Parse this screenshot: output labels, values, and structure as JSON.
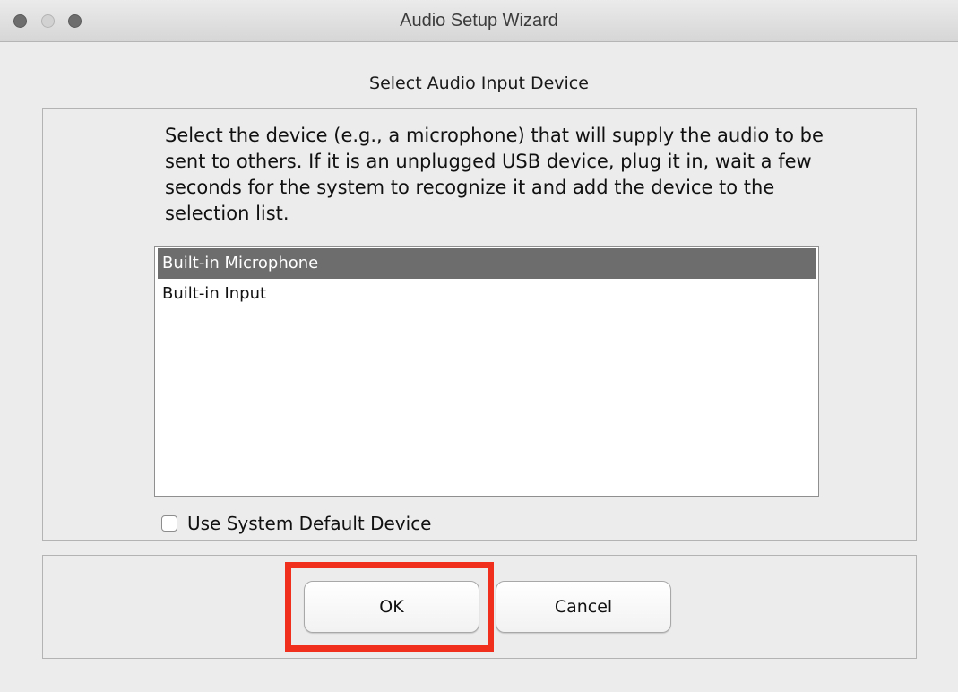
{
  "window": {
    "title": "Audio Setup Wizard"
  },
  "main": {
    "heading": "Select Audio Input Device",
    "instructions": "Select the device (e.g., a microphone) that will supply the audio to be sent to others.  If it is an unplugged USB device, plug it in, wait a few seconds for the system to recognize it and add the device to the selection list.",
    "devices": [
      {
        "label": "Built-in Microphone",
        "selected": true
      },
      {
        "label": "Built-in Input",
        "selected": false
      }
    ],
    "use_default_checkbox": {
      "label": "Use System Default Device",
      "checked": false
    }
  },
  "buttons": {
    "ok_label": "OK",
    "cancel_label": "Cancel"
  },
  "colors": {
    "highlight": "#f0301c",
    "selection": "#6d6d6d"
  }
}
